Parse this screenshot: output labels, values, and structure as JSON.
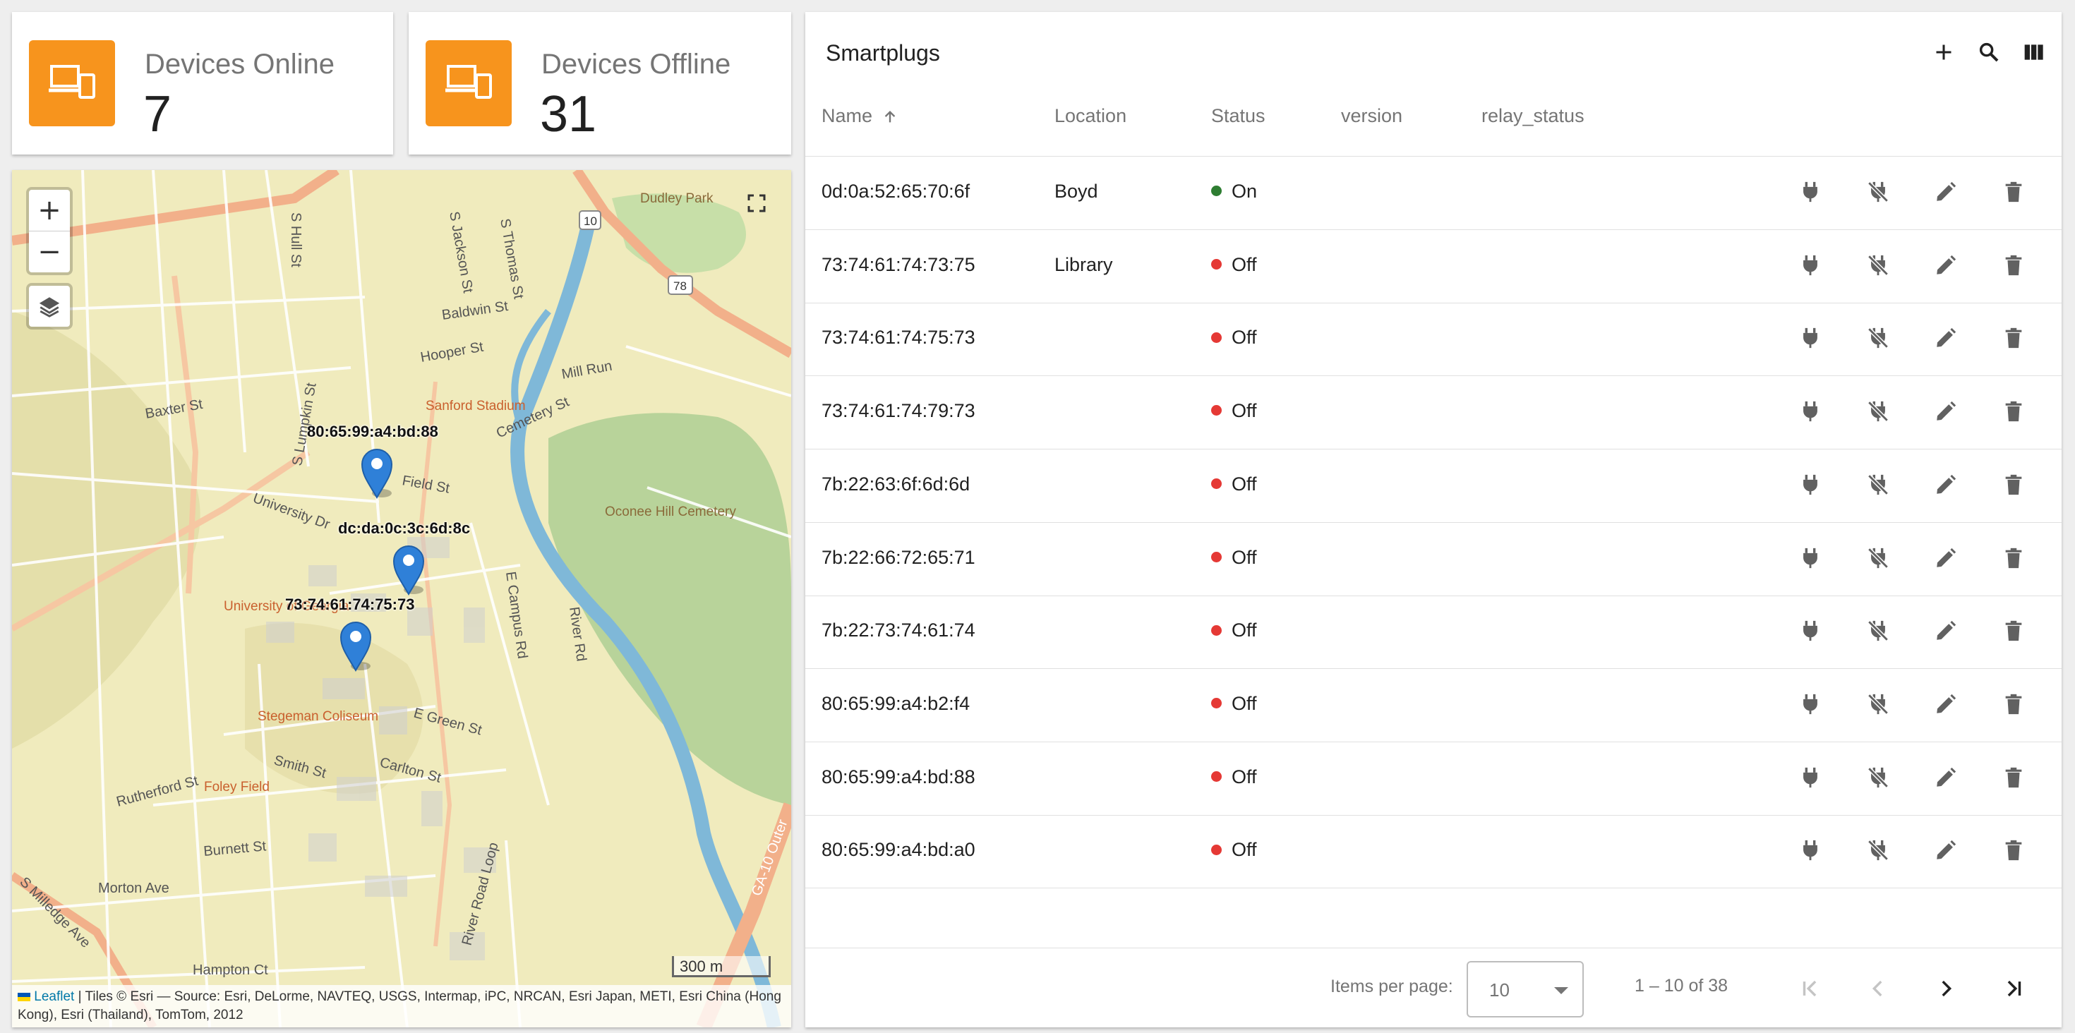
{
  "stats": {
    "online": {
      "label": "Devices Online",
      "value": "7",
      "icon": "devices-icon"
    },
    "offline": {
      "label": "Devices Offline",
      "value": "31",
      "icon": "devices-icon"
    }
  },
  "map": {
    "zoom_in": "+",
    "zoom_out": "−",
    "markers": [
      {
        "label": "80:65:99:a4:bd:88"
      },
      {
        "label": "dc:da:0c:3c:6d:8c"
      },
      {
        "label": "73:74:61:74:75:73"
      }
    ],
    "place_labels": {
      "dudley": "Dudley Park",
      "sanford": "Sanford Stadium",
      "oconee": "Oconee Hill Cemetery",
      "uga": "University of Georgia",
      "stegeman": "Stegeman Coliseum",
      "foley": "Foley Field",
      "s_hull": "S Hull St",
      "jackson": "S Jackson St",
      "thomas": "S Thomas St",
      "baldwin": "Baldwin St",
      "hooper": "Hooper St",
      "baxter": "Baxter St",
      "field": "Field St",
      "university": "University Dr",
      "mill_run": "Mill Run",
      "cemetery": "Cemetery St",
      "campus": "E Campus Rd",
      "river": "River Rd",
      "green": "E Green St",
      "carlton": "Carlton St",
      "smith": "Smith St",
      "rutherford": "Rutherford St",
      "burnett": "Burnett St",
      "morton": "Morton Ave",
      "hampton": "Hampton Ct",
      "river_loop": "River Road Loop",
      "lumpkin": "S Lumpkin St",
      "milledge": "S Milledge Ave",
      "ga10": "GA-10 Outer",
      "route10": "10",
      "route78": "78"
    },
    "scale": "300 m",
    "attribution_link": "Leaflet",
    "attribution_text": " | Tiles © Esri — Source: Esri, DeLorme, NAVTEQ, USGS, Intermap, iPC, NRCAN, Esri Japan, METI, Esri China (Hong Kong), Esri (Thailand), TomTom, 2012"
  },
  "table": {
    "title": "Smartplugs",
    "columns": {
      "name": "Name",
      "location": "Location",
      "status": "Status",
      "version": "version",
      "relay_status": "relay_status"
    },
    "colors": {
      "on": "#2e7d32",
      "off": "#e53935",
      "accent": "#f7941d"
    },
    "rows": [
      {
        "name": "0d:0a:52:65:70:6f",
        "location": "Boyd",
        "status": "On"
      },
      {
        "name": "73:74:61:74:73:75",
        "location": "Library",
        "status": "Off"
      },
      {
        "name": "73:74:61:74:75:73",
        "location": "",
        "status": "Off"
      },
      {
        "name": "73:74:61:74:79:73",
        "location": "",
        "status": "Off"
      },
      {
        "name": "7b:22:63:6f:6d:6d",
        "location": "",
        "status": "Off"
      },
      {
        "name": "7b:22:66:72:65:71",
        "location": "",
        "status": "Off"
      },
      {
        "name": "7b:22:73:74:61:74",
        "location": "",
        "status": "Off"
      },
      {
        "name": "80:65:99:a4:b2:f4",
        "location": "",
        "status": "Off"
      },
      {
        "name": "80:65:99:a4:bd:88",
        "location": "",
        "status": "Off"
      },
      {
        "name": "80:65:99:a4:bd:a0",
        "location": "",
        "status": "Off"
      }
    ],
    "row_actions": [
      "plug-icon",
      "plug-off-icon",
      "edit-icon",
      "delete-icon"
    ]
  },
  "paginator": {
    "items_per_page_label": "Items per page:",
    "items_per_page": "10",
    "range": "1 – 10 of 38"
  }
}
